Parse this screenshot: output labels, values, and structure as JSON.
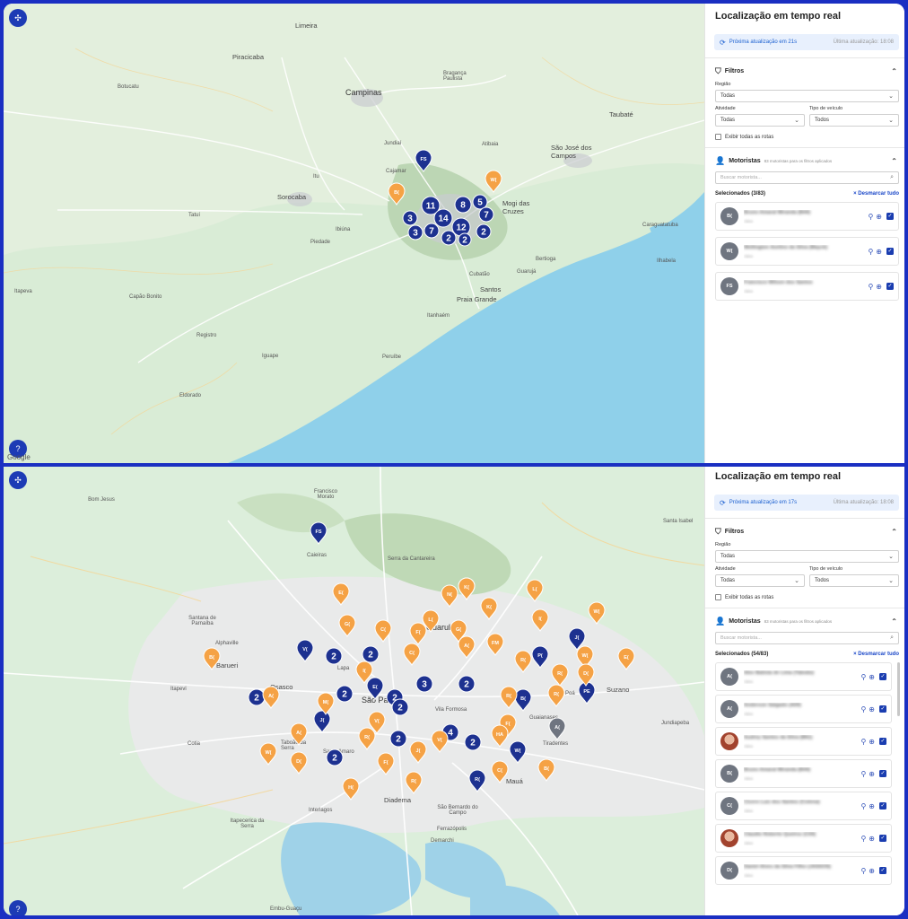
{
  "panel_top": {
    "title": "Localização em tempo real",
    "next_update": "Próxima atualização em 21s",
    "last_update": "Última atualização: 18:08",
    "filters_title": "Filtros",
    "region_label": "Região",
    "region_value": "Todas",
    "activity_label": "Atividade",
    "activity_value": "Todas",
    "vehicle_label": "Tipo de veículo",
    "vehicle_value": "Todos",
    "show_routes_label": "Exibir todas as rotas",
    "drivers_title": "Motoristas",
    "drivers_sub": "83 motoristas para os filtros aplicados",
    "search_placeholder": "Buscar motorista...",
    "selected": "Selecionados (3/83)",
    "clear_all": "× Desmarcar tudo",
    "drivers": [
      {
        "initials": "B(",
        "name": "Bruno Amaral Miranda (B44)",
        "status": "Ativo"
      },
      {
        "initials": "W(",
        "name": "Wellington Avelino da Silva (Mayck)",
        "status": "Ativo"
      },
      {
        "initials": "FS",
        "name": "Francisco Wilson dos Santos",
        "status": "Ativo"
      }
    ]
  },
  "panel_bottom": {
    "title": "Localização em tempo real",
    "next_update": "Próxima atualização em 17s",
    "last_update": "Última atualização: 18:08",
    "filters_title": "Filtros",
    "region_label": "Região",
    "region_value": "Todas",
    "activity_label": "Atividade",
    "activity_value": "Todas",
    "vehicle_label": "Tipo de veículo",
    "vehicle_value": "Todos",
    "show_routes_label": "Exibir todas as rotas",
    "drivers_title": "Motoristas",
    "drivers_sub": "83 motoristas para os filtros aplicados",
    "search_placeholder": "Buscar motorista...",
    "selected": "Selecionados (54/83)",
    "clear_all": "× Desmarcar tudo",
    "drivers": [
      {
        "initials": "A(",
        "name": "Alex Batista de Lima (Taboão)",
        "status": "Ativo"
      },
      {
        "initials": "A(",
        "name": "Anderson Salgado (A00)",
        "status": "Ativo"
      },
      {
        "initials": "",
        "name": "Audrey Santos da Silva (B61)",
        "status": "Ativo"
      },
      {
        "initials": "B(",
        "name": "Bruno Amaral Miranda (B44)",
        "status": "Ativo"
      },
      {
        "initials": "C(",
        "name": "Cicero Luiz dos Santos (Cotena)",
        "status": "Ativo"
      },
      {
        "initials": "",
        "name": "Claudio Roberto Queiroz (C04)",
        "status": "Ativo"
      },
      {
        "initials": "D(",
        "name": "Daniel Alves da Silva Filho (JASSOS)",
        "status": "Ativo"
      }
    ]
  },
  "map_top": {
    "labels": [
      "Limeira",
      "Campinas",
      "Piracicaba",
      "Jundiaí",
      "Sorocaba",
      "Taubaté",
      "São José dos Campos",
      "Mogi das Cruzes",
      "Guarujá",
      "Santos",
      "Praia Grande",
      "Itapeva",
      "Capão Bonito",
      "Tatuí",
      "Botucatu",
      "Itu",
      "Atibaia",
      "Bragança Paulista",
      "Caraguatatuba",
      "Ilhabela",
      "Peruíbe",
      "Registro",
      "Itanhaém",
      "Eldorado",
      "Iguape",
      "Piedade",
      "Ibiúna",
      "Cajamar",
      "Cubatão",
      "Bertioga"
    ],
    "clusters": [
      "11",
      "14",
      "12",
      "8",
      "5",
      "7",
      "3",
      "3",
      "7",
      "2",
      "2",
      "2"
    ],
    "pins": [
      {
        "label": "FS",
        "color": "#1d3190"
      },
      {
        "label": "B(",
        "color": "#f5a245"
      },
      {
        "label": "W(",
        "color": "#f5a245"
      }
    ],
    "google": "Google"
  },
  "map_bottom": {
    "labels": [
      "Guarulhos",
      "São Paulo",
      "Osasco",
      "Barueri",
      "Diadema",
      "Mauá",
      "Suzano",
      "Itapevi",
      "Caieiras",
      "Lapa",
      "Santo Amaro",
      "Interlagos",
      "São Bernardo do Campo",
      "Vila Formosa",
      "Itapecerica da Serra",
      "Ferrazópolis",
      "Tiradentes",
      "Guaianases",
      "Alphaville",
      "Embu-Guaçu",
      "Cotia",
      "Santana de Parnaíba",
      "Francisco Morato",
      "Bom Jesus",
      "Serra da Cantareira",
      "Taboão da Serra",
      "Demarchi",
      "Jundiapeba",
      "Santa Isabel",
      "Poá"
    ],
    "clusters": [
      "2",
      "2",
      "2",
      "2",
      "2",
      "2",
      "3",
      "2",
      "4",
      "2",
      "2",
      "2"
    ],
    "pins_blue": [
      "FS",
      "V(",
      "E(",
      "K(",
      "J(",
      "P(",
      "B(",
      "PE",
      "W(",
      "R(",
      "J("
    ],
    "pins_orange": [
      "E(",
      "G(",
      "C(",
      "B(",
      "A(",
      "M(",
      "A(",
      "W(",
      "D(",
      "H(",
      "V(",
      "R(",
      "F(",
      "C(",
      "I(",
      "K(",
      "L(",
      "F(",
      "G(",
      "A(",
      "FM",
      "N(",
      "K(",
      "L(",
      "W(",
      "I(",
      "W(",
      "E(",
      "D(",
      "R(",
      "R(",
      "R(",
      "R(",
      "F(",
      "HA",
      "C(",
      "B(",
      "J(",
      "V(",
      "R("
    ],
    "pins_gray": [
      "A("
    ]
  }
}
